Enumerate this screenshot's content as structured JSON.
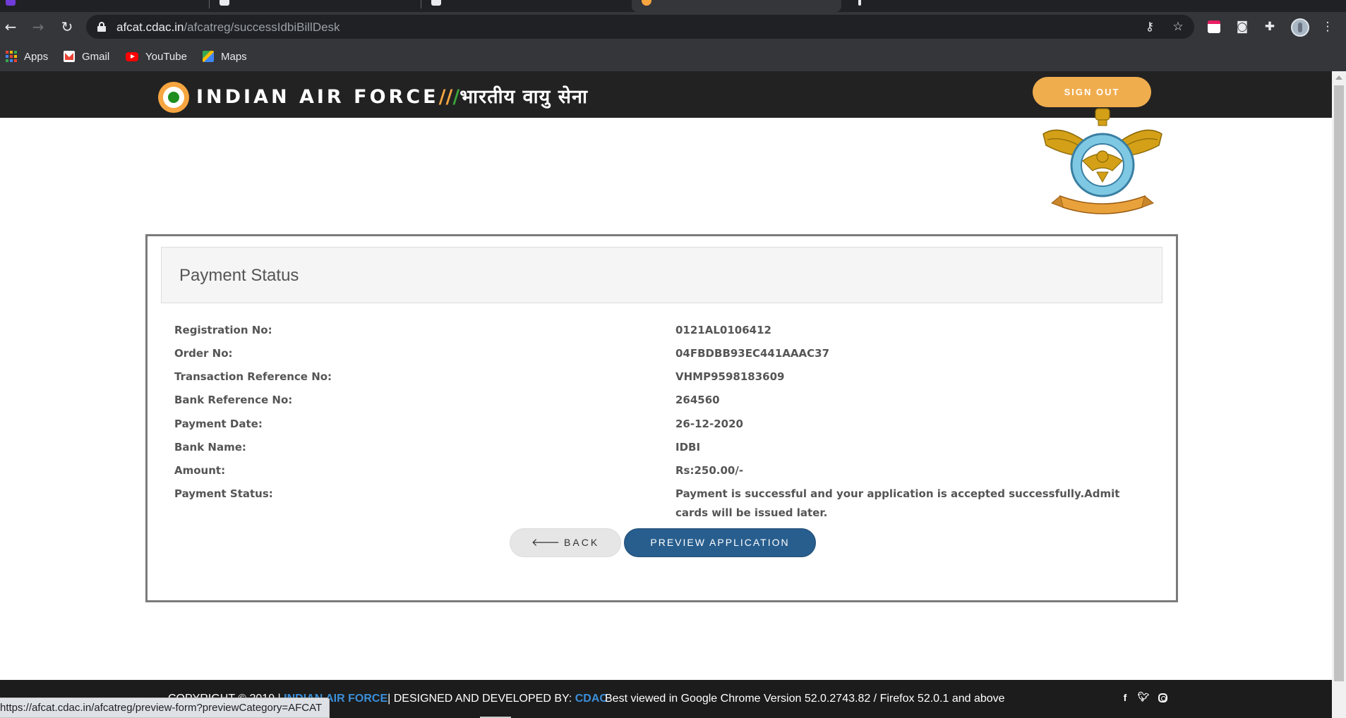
{
  "browser": {
    "url_host": "afcat.cdac.in",
    "url_path": "/afcatreg/successIdbiBillDesk",
    "bookmarks": [
      {
        "label": "Apps",
        "icon": "apps-grid-icon"
      },
      {
        "label": "Gmail",
        "icon": "gmail-icon"
      },
      {
        "label": "YouTube",
        "icon": "youtube-icon"
      },
      {
        "label": "Maps",
        "icon": "maps-icon"
      }
    ],
    "status_url": "https://afcat.cdac.in/afcatreg/preview-form?previewCategory=AFCAT"
  },
  "header": {
    "brand_en": "INDIAN AIR FORCE",
    "brand_sep1": "/",
    "brand_sep2": "/",
    "brand_hi": "भारतीय वायु सेना",
    "signout_label": "SIGN OUT",
    "colors": {
      "saffron": "#f7a540",
      "green": "#3aa63a",
      "header_bg": "#222222"
    }
  },
  "panel": {
    "title": "Payment Status",
    "rows": [
      {
        "label": "Registration No:",
        "value": "0121AL0106412"
      },
      {
        "label": "Order No:",
        "value": "04FBDBB93EC441AAAC37"
      },
      {
        "label": "Transaction Reference No:",
        "value": "VHMP9598183609"
      },
      {
        "label": "Bank Reference No:",
        "value": "264560"
      },
      {
        "label": "Payment Date:",
        "value": "26-12-2020"
      },
      {
        "label": "Bank Name:",
        "value": "IDBI"
      },
      {
        "label": "Amount:",
        "value": "Rs:250.00/-"
      },
      {
        "label": "Payment Status:",
        "value": "Payment is successful and your application is accepted successfully.Admit cards will be issued later."
      }
    ],
    "back_label": "BACK",
    "preview_label": "PREVIEW APPLICATION"
  },
  "footer": {
    "copyright_prefix": "COPYRIGHT © 2019 |",
    "iaf_link": "INDIAN AIR FORCE",
    "designed_by": "| DESIGNED AND DEVELOPED BY:",
    "cdac_link": "CDAC",
    "best_viewed": "Best viewed in Google Chrome Version 52.0.2743.82 / Firefox 52.0.1 and above",
    "social_icons": [
      "facebook-icon",
      "twitter-icon",
      "instagram-icon"
    ]
  }
}
